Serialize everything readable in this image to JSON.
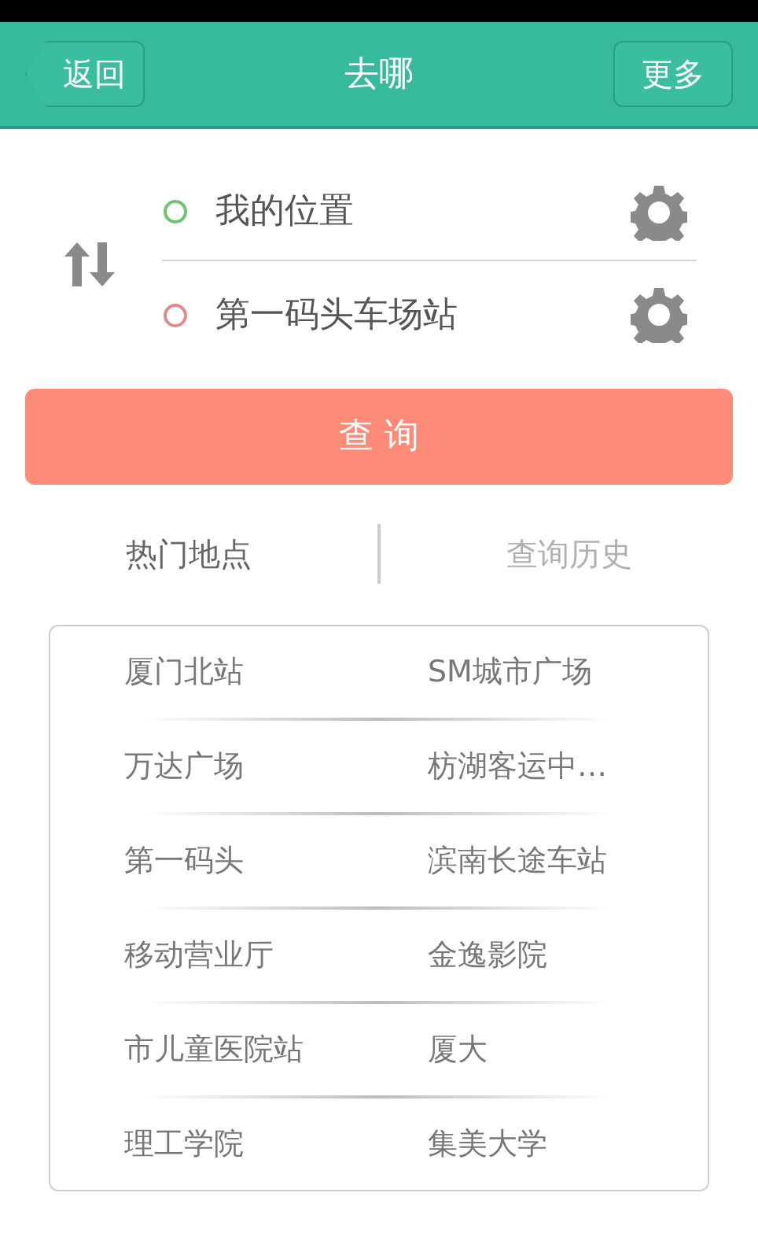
{
  "header": {
    "back": "返回",
    "title": "去哪",
    "more": "更多"
  },
  "route": [
    {
      "value": "我的位置",
      "color": "#6cc56c"
    },
    {
      "value": "第一码头车场站",
      "color": "#e08a8a"
    }
  ],
  "search_button": "查 询",
  "tabs": [
    {
      "label": "热门地点",
      "selected": true
    },
    {
      "label": "查询历史",
      "selected": false
    }
  ],
  "places": [
    [
      "厦门北站",
      "SM城市广场"
    ],
    [
      "万达广场",
      "枋湖客运中…"
    ],
    [
      "第一码头",
      "滨南长途车站"
    ],
    [
      "移动营业厅",
      "金逸影院"
    ],
    [
      "市儿童医院站",
      "厦大"
    ],
    [
      "理工学院",
      "集美大学"
    ]
  ]
}
